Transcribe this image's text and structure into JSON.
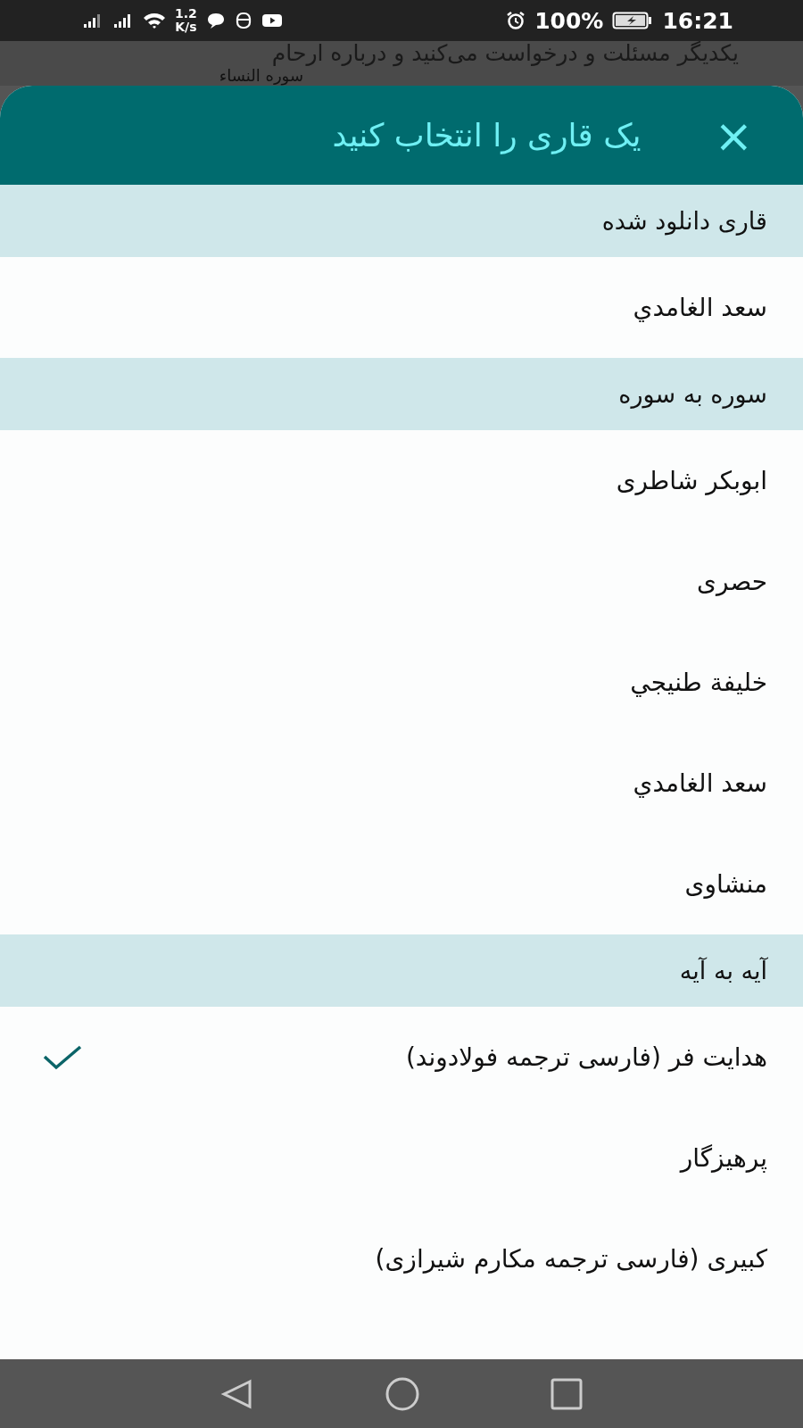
{
  "status_bar": {
    "speed_value": "1.2",
    "speed_unit": "K/s",
    "battery": "100%",
    "time": "16:21"
  },
  "background": {
    "line": "یکدیگر مسئلت و درخواست می‌کنید و درباره ارحام",
    "caption": "سوره النساء"
  },
  "sheet": {
    "title": "یک قاری را انتخاب کنید",
    "close": "×",
    "sections": [
      {
        "title": "قاری دانلود شده",
        "items": [
          {
            "label": "سعد الغامدي",
            "selected": false
          }
        ]
      },
      {
        "title": "سوره به سوره",
        "items": [
          {
            "label": "ابوبکر شاطری",
            "selected": false
          },
          {
            "label": "حصری",
            "selected": false
          },
          {
            "label": "خليفة طنيجي",
            "selected": false
          },
          {
            "label": "سعد الغامدي",
            "selected": false
          },
          {
            "label": "منشاوی",
            "selected": false
          }
        ]
      },
      {
        "title": "آیه به آیه",
        "items": [
          {
            "label": "هدایت فر (فارسی ترجمه فولادوند)",
            "selected": true
          },
          {
            "label": "پرهیزگار",
            "selected": false
          },
          {
            "label": "کبیری (فارسی ترجمه مکارم شیرازی)",
            "selected": false
          }
        ]
      }
    ]
  }
}
